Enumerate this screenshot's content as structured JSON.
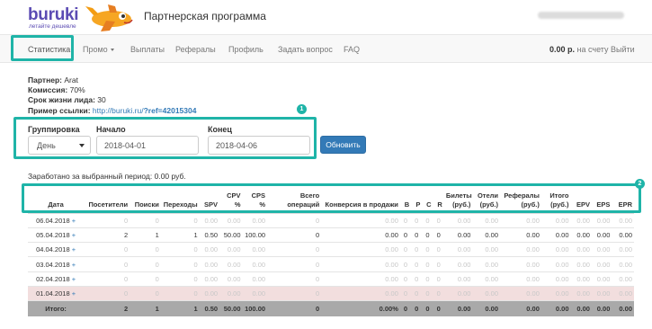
{
  "header": {
    "logo_text": "buruki",
    "logo_tagline": "летайте дешевле",
    "program_title": "Партнерская программа"
  },
  "nav": {
    "items": [
      "Статистика",
      "Промо",
      "Выплаты",
      "Рефералы",
      "Профиль",
      "Задать вопрос",
      "FAQ"
    ],
    "balance_amount": "0.00 р.",
    "balance_suffix": "на счету",
    "logout": "Выйти"
  },
  "info": {
    "partner_label": "Партнер:",
    "partner_value": "Arat",
    "commission_label": "Комиссия:",
    "commission_value": "70%",
    "lead_life_label": "Срок жизни лида:",
    "lead_life_value": "30",
    "link_label": "Пример ссылки:",
    "link_prefix": "http://buruki.ru/",
    "link_ref": "?ref=42015304"
  },
  "filter": {
    "grouping_label": "Группировка",
    "grouping_value": "День",
    "start_label": "Начало",
    "start_value": "2018-04-01",
    "end_label": "Конец",
    "end_value": "2018-04-06",
    "update_button": "Обновить"
  },
  "badges": [
    "1",
    "2"
  ],
  "earned": "Заработано за выбранный период: 0.00 руб.",
  "table": {
    "headers": [
      "Дата",
      "Посетители",
      "Поиски",
      "Переходы",
      "SPV",
      "CPV %",
      "CPS %",
      "Всего операций",
      "Конверсия в продажи",
      "B",
      "P",
      "C",
      "R",
      "Билеты (руб.)",
      "Отели (руб.)",
      "Рефералы (руб.)",
      "Итого (руб.)",
      "EPV",
      "EPS",
      "EPR"
    ],
    "rows": [
      {
        "date": "06.04.2018",
        "plus": "+",
        "weekend": false,
        "zero": true,
        "cells": [
          "0",
          "0",
          "0",
          "0.00",
          "0.00",
          "0.00",
          "0",
          "0.00",
          "0",
          "0",
          "0",
          "0",
          "0.00",
          "0.00",
          "0.00",
          "0.00",
          "0.00",
          "0.00",
          "0.00"
        ]
      },
      {
        "date": "05.04.2018",
        "plus": "+",
        "weekend": false,
        "zero": false,
        "cells": [
          "2",
          "1",
          "1",
          "0.50",
          "50.00",
          "100.00",
          "0",
          "0.00",
          "0",
          "0",
          "0",
          "0",
          "0.00",
          "0.00",
          "0.00",
          "0.00",
          "0.00",
          "0.00",
          "0.00"
        ]
      },
      {
        "date": "04.04.2018",
        "plus": "+",
        "weekend": false,
        "zero": true,
        "cells": [
          "0",
          "0",
          "0",
          "0.00",
          "0.00",
          "0.00",
          "0",
          "0.00",
          "0",
          "0",
          "0",
          "0",
          "0.00",
          "0.00",
          "0.00",
          "0.00",
          "0.00",
          "0.00",
          "0.00"
        ]
      },
      {
        "date": "03.04.2018",
        "plus": "+",
        "weekend": false,
        "zero": true,
        "cells": [
          "0",
          "0",
          "0",
          "0.00",
          "0.00",
          "0.00",
          "0",
          "0.00",
          "0",
          "0",
          "0",
          "0",
          "0.00",
          "0.00",
          "0.00",
          "0.00",
          "0.00",
          "0.00",
          "0.00"
        ]
      },
      {
        "date": "02.04.2018",
        "plus": "+",
        "weekend": false,
        "zero": true,
        "cells": [
          "0",
          "0",
          "0",
          "0.00",
          "0.00",
          "0.00",
          "0",
          "0.00",
          "0",
          "0",
          "0",
          "0",
          "0.00",
          "0.00",
          "0.00",
          "0.00",
          "0.00",
          "0.00",
          "0.00"
        ]
      },
      {
        "date": "01.04.2018",
        "plus": "+",
        "weekend": true,
        "zero": true,
        "cells": [
          "0",
          "0",
          "0",
          "0.00",
          "0.00",
          "0.00",
          "0",
          "0.00",
          "0",
          "0",
          "0",
          "0",
          "0.00",
          "0.00",
          "0.00",
          "0.00",
          "0.00",
          "0.00",
          "0.00"
        ]
      }
    ],
    "total": {
      "label": "Итого:",
      "cells": [
        "2",
        "1",
        "1",
        "0.50",
        "50.00",
        "100.00",
        "0",
        "0.00%",
        "0",
        "0",
        "0",
        "0",
        "0.00",
        "0.00",
        "0.00",
        "0.00",
        "0.00",
        "0.00",
        "0.00"
      ]
    }
  },
  "colors": {
    "accent": "#1fb4a8",
    "brand": "#5b4bb3",
    "primary": "#337ab7",
    "weekend": "#f2dede",
    "total": "#a9a9a9"
  }
}
